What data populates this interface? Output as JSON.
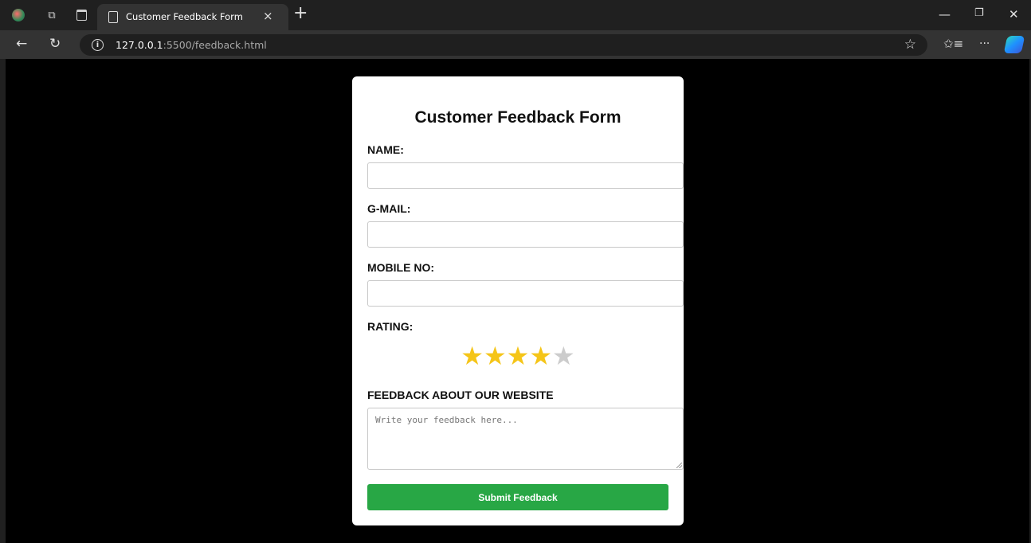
{
  "browser": {
    "tab_title": "Customer Feedback Form",
    "tab_close": "×",
    "new_tab": "+",
    "url_host": "127.0.0.1",
    "url_rest": ":5500/feedback.html",
    "info_glyph": "i",
    "window_controls": {
      "minimize": "—",
      "restore": "❐",
      "close": "✕"
    },
    "icons": [
      "profile-avatar-icon",
      "workspaces-icon",
      "tab-actions-icon",
      "page-icon",
      "back-icon",
      "refresh-icon",
      "info-icon",
      "favorite-star-icon",
      "favorites-list-icon",
      "more-icon",
      "copilot-icon"
    ]
  },
  "form": {
    "title": "Customer Feedback Form",
    "name_label": "NAME:",
    "name_value": "",
    "gmail_label": "G-MAIL:",
    "gmail_value": "",
    "mobile_label": "MOBILE NO:",
    "mobile_value": "",
    "rating_label": "RATING:",
    "rating": {
      "value": 4,
      "max": 5,
      "star_glyph": "★",
      "on_color": "#f5c518",
      "off_color": "#cccccc"
    },
    "feedback_label": "FEEDBACK ABOUT OUR WEBSITE",
    "feedback_placeholder": "Write your feedback here...",
    "submit_label": "Submit Feedback",
    "submit_color": "#28a745"
  }
}
